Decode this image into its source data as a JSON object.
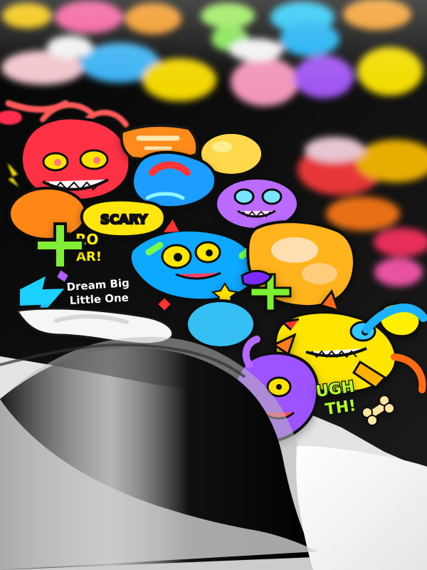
{
  "stickers": {
    "dream_line_1": "Dream Big",
    "dream_line_2": "Little One",
    "scary_label": "SCARY",
    "roar_line_1": "RO",
    "roar_line_2": "AR!",
    "ugh_line_1": "UGH",
    "ugh_line_2": "TH!"
  },
  "colors": {
    "backing": "#090909",
    "paper": "#f6f6f6",
    "orange": "#ff8a16",
    "yellow": "#ffe300",
    "cyan": "#18c7ff",
    "pink": "#ff4f8b",
    "purple": "#8d45ff",
    "green": "#74f04f",
    "red": "#ff3131"
  }
}
